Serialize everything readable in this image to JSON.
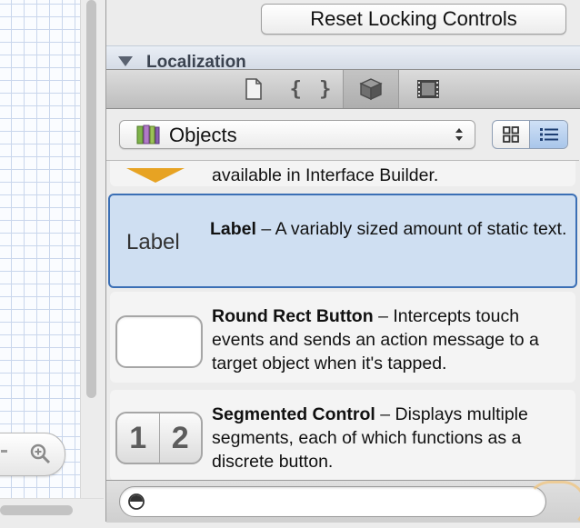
{
  "inspector": {
    "reset_button_label": "Reset Locking Controls",
    "localization_section_title": "Localization"
  },
  "toolbar": {
    "tabs": [
      {
        "icon": "file-template-icon",
        "active": false
      },
      {
        "icon": "code-snippet-icon",
        "label": "{ }",
        "active": false
      },
      {
        "icon": "object-library-icon",
        "active": true
      },
      {
        "icon": "media-library-icon",
        "active": false
      }
    ]
  },
  "library": {
    "selector_value": "Objects",
    "view_mode": "list",
    "items": [
      {
        "name": "",
        "description": "available in Interface Builder.",
        "preview": "cube-icon",
        "selected": false
      },
      {
        "name": "Label",
        "separator": "–",
        "description": "A variably sized amount of static text.",
        "preview_text": "Label",
        "selected": true
      },
      {
        "name": "Round Rect Button",
        "separator": "–",
        "description": "Intercepts touch events and sends an action message to a target object when it's tapped.",
        "selected": false
      },
      {
        "name": "Segmented Control",
        "separator": "–",
        "description": "Displays multiple segments, each of which functions as a discrete button.",
        "preview_segments": [
          "1",
          "2"
        ],
        "selected": false
      }
    ]
  },
  "filter": {
    "value": "",
    "placeholder": ""
  },
  "colors": {
    "selection_fill": "#cfdff2",
    "selection_border": "#3b6fb5",
    "cube_accent": "#e7a323"
  }
}
